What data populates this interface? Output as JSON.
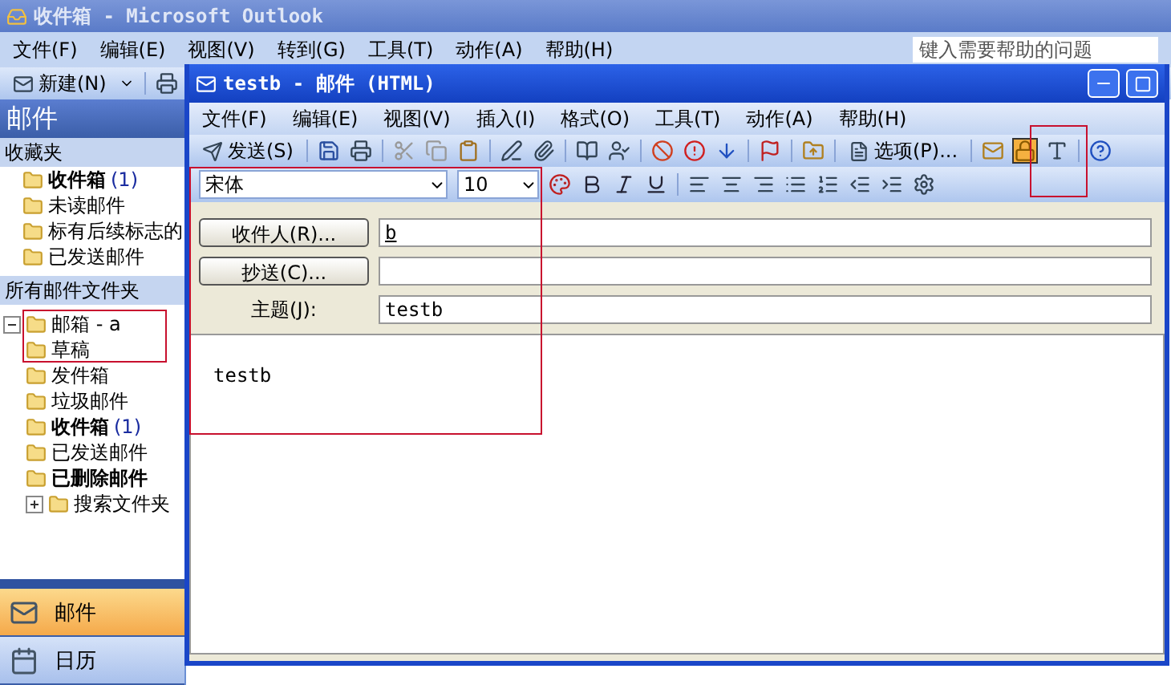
{
  "main_window": {
    "title": "收件箱 - Microsoft Outlook",
    "menu": [
      "文件(F)",
      "编辑(E)",
      "视图(V)",
      "转到(G)",
      "工具(T)",
      "动作(A)",
      "帮助(H)"
    ],
    "help_box": {
      "placeholder": "键入需要帮助的问题"
    },
    "toolbar": {
      "new_button": "新建(N)"
    }
  },
  "navigation_pane": {
    "title": "邮件",
    "favorites_header": "收藏夹",
    "favorites": [
      {
        "label": "收件箱",
        "count": "(1)",
        "unread": true
      },
      {
        "label": "未读邮件",
        "unread": false
      },
      {
        "label": "标有后续标志的",
        "unread": false
      },
      {
        "label": "已发送邮件",
        "unread": false
      }
    ],
    "folders_header": "所有邮件文件夹",
    "tree": [
      {
        "label": "邮箱 - a",
        "unread": false,
        "expanded": true,
        "children": [
          {
            "label": "草稿",
            "unread": false
          },
          {
            "label": "发件箱",
            "unread": false
          },
          {
            "label": "垃圾邮件",
            "unread": false
          },
          {
            "label": "收件箱",
            "count": "(1)",
            "unread": true
          },
          {
            "label": "已发送邮件",
            "unread": false
          },
          {
            "label": "已删除邮件",
            "unread": true
          },
          {
            "label": "搜索文件夹",
            "unread": false,
            "expanded": false
          }
        ]
      }
    ],
    "buttons": [
      {
        "label": "邮件",
        "kind": "mail",
        "selected": true
      },
      {
        "label": "日历",
        "kind": "calendar",
        "selected": false
      }
    ]
  },
  "compose_window": {
    "title": "testb - 邮件 (HTML)",
    "menu": [
      "文件(F)",
      "编辑(E)",
      "视图(V)",
      "插入(I)",
      "格式(O)",
      "工具(T)",
      "动作(A)",
      "帮助(H)"
    ],
    "toolbar": {
      "send_button": "发送(S)",
      "options_button": "选项(P)..."
    },
    "format_bar": {
      "font": "宋体",
      "size": "10"
    },
    "to_button": "收件人(R)...",
    "to_value": "b",
    "cc_button": "抄送(C)...",
    "subject_label": "主题(J):",
    "subject_value": "testb",
    "body": "testb"
  }
}
